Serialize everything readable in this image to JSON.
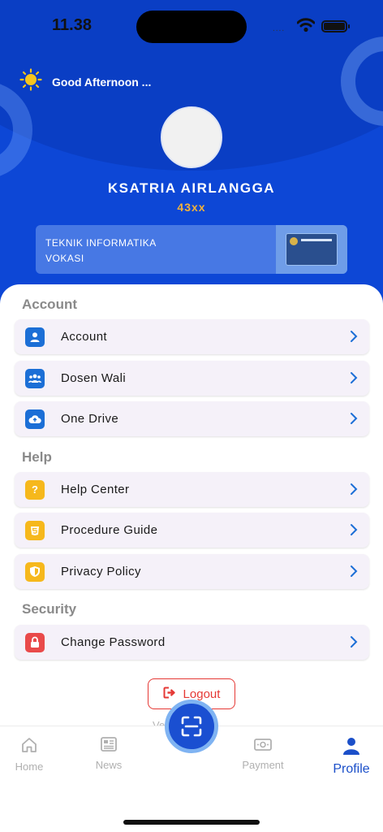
{
  "status_bar": {
    "time": "11.38",
    "signal_dots": "...."
  },
  "header": {
    "greeting": "Good Afternoon ...",
    "name": "KSATRIA AIRLANGGA",
    "student_id": "43xx",
    "program_line1": "TEKNIK INFORMATIKA",
    "program_line2": "VOKASI"
  },
  "sections": {
    "account_title": "Account",
    "help_title": "Help",
    "security_title": "Security"
  },
  "menu": {
    "account": "Account",
    "dosen_wali": "Dosen Wali",
    "one_drive": "One Drive",
    "help_center": "Help Center",
    "procedure_guide": "Procedure Guide",
    "privacy_policy": "Privacy Policy",
    "change_password": "Change Password"
  },
  "logout_label": "Logout",
  "version_text": "Ve              .0",
  "nav": {
    "home": "Home",
    "news": "News",
    "payment": "Payment",
    "profile": "Profile",
    "active": "profile"
  },
  "colors": {
    "primary": "#0d47d6",
    "accent_gold": "#f3b23a",
    "logout_red": "#e53935",
    "nav_active": "#1b4fc9"
  },
  "icons": {
    "greeting": "sun-icon",
    "account": "person-icon",
    "dosen_wali": "group-icon",
    "one_drive": "cloud-upload-icon",
    "help_center": "question-icon",
    "procedure_guide": "guide-icon",
    "privacy_policy": "shield-icon",
    "change_password": "lock-icon",
    "logout": "logout-icon",
    "scan": "scan-icon"
  }
}
